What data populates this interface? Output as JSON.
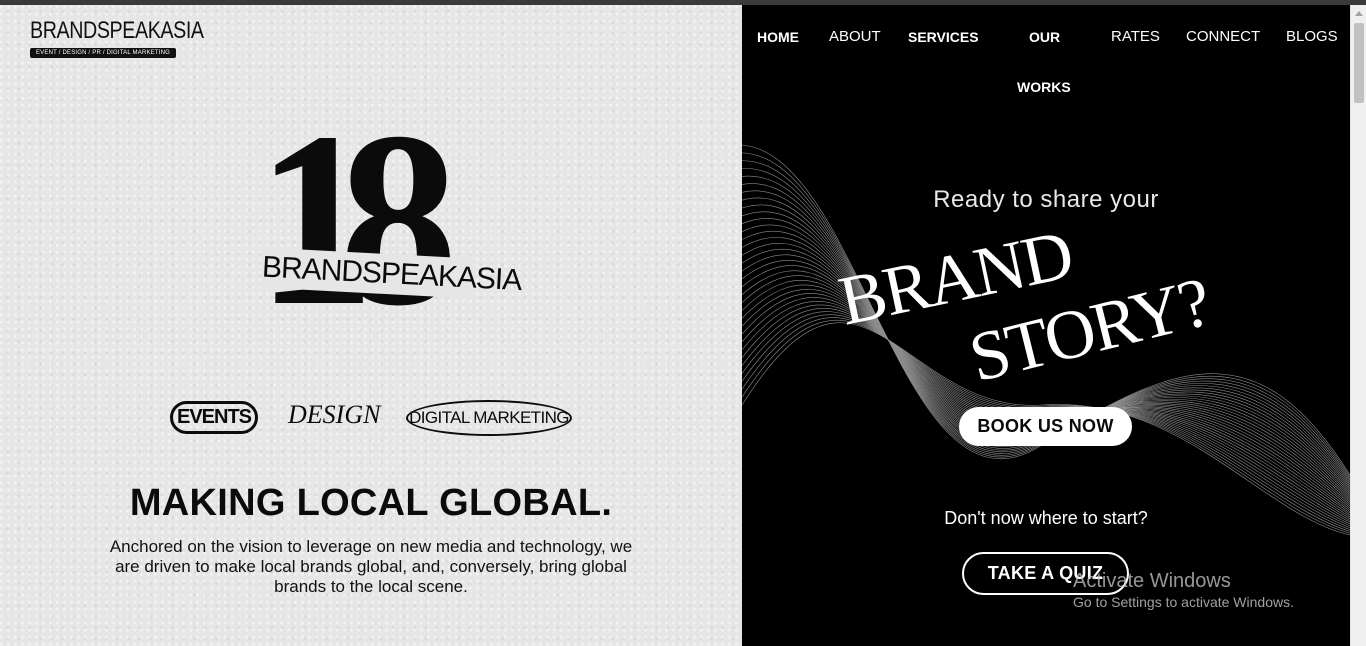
{
  "brand": {
    "name": "BRANDSPEAKASIA",
    "tagline": "EVENT / DESIGN / PR / DIGITAL MARKETING"
  },
  "nav": {
    "home": "HOME",
    "about": "ABOUT",
    "services": "SERVICES",
    "our": "OUR",
    "works": "WORKS",
    "rates": "RATES",
    "connect": "CONNECT",
    "blogs": "BLOGS"
  },
  "emblem": {
    "number": "18",
    "band": "BRANDSPEAKASIA"
  },
  "services": {
    "events": "EVENTS",
    "design": "DESIGN",
    "digital": "DIGITAL MARKETING"
  },
  "hero_left": {
    "headline": "MAKING LOCAL GLOBAL.",
    "description": "Anchored on the vision to leverage on new media and technology, we are driven to make local brands global, and, conversely, bring global brands to the local scene."
  },
  "hero_right": {
    "intro": "Ready to share your",
    "brand_word": "BRAND",
    "story_word": "STORY?",
    "book_button": "BOOK US NOW",
    "question": "Don't now where to start?",
    "quiz_button": "TAKE A QUIZ"
  },
  "watermark": {
    "title": "Activate Windows",
    "subtitle": "Go to Settings to activate Windows."
  },
  "colors": {
    "left_background": "#e6e6e6",
    "right_background": "#000000",
    "text_dark": "#0b0b0b",
    "text_light": "#ffffff"
  }
}
